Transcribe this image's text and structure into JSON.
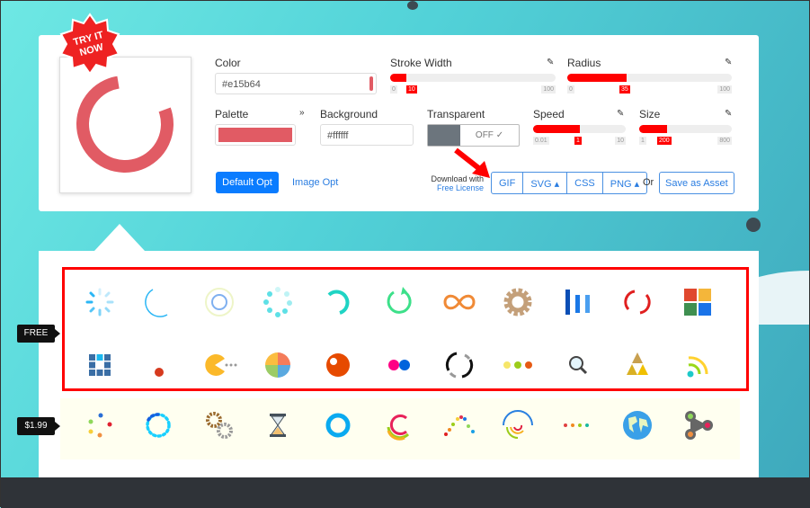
{
  "badge": "TRY IT NOW",
  "preview": {
    "color": "#e15b64"
  },
  "color": {
    "label": "Color",
    "value": "#e15b64"
  },
  "stroke_width": {
    "label": "Stroke Width",
    "min": "0",
    "value": "10",
    "max": "100",
    "fraction": 0.1
  },
  "radius": {
    "label": "Radius",
    "min": "0",
    "value": "35",
    "max": "100",
    "fraction": 0.35
  },
  "palette": {
    "label": "Palette",
    "swatch": "#e15b64"
  },
  "background": {
    "label": "Background",
    "value": "#ffffff"
  },
  "transparent": {
    "label": "Transparent",
    "state": "OFF ✓"
  },
  "speed": {
    "label": "Speed",
    "min": "0.01",
    "value": "1",
    "max": "10",
    "fraction": 0.5
  },
  "size": {
    "label": "Size",
    "min": "1",
    "value": "200",
    "max": "800",
    "fraction": 0.3
  },
  "buttons": {
    "default_opt": "Default Opt",
    "image_opt": "Image Opt",
    "download_with": "Download with",
    "free_license": "Free License",
    "gif": "GIF",
    "svg": "SVG ▴",
    "css": "CSS",
    "png": "PNG ▴",
    "or": "Or",
    "save_asset": "Save as Asset"
  },
  "tags": {
    "free": "FREE",
    "paid": "$1.99"
  },
  "free_icons": [
    "spinner",
    "ring",
    "dual-ring",
    "ellipsis-spinner",
    "arc",
    "rolling-arrow",
    "infinity",
    "gear",
    "bars",
    "double-ring",
    "blocks",
    "grid",
    "bouncing-ball",
    "pacman",
    "pie",
    "ball",
    "flickr",
    "circle-arcs",
    "ellipsis",
    "magnify",
    "triangles",
    "wifi"
  ],
  "paid_icons": [
    "dots-circle",
    "dots-ring",
    "gears",
    "hourglass",
    "ring-glossy",
    "color-arcs",
    "dots-wave",
    "radar",
    "dots-line",
    "globe",
    "fidget-spinner"
  ]
}
